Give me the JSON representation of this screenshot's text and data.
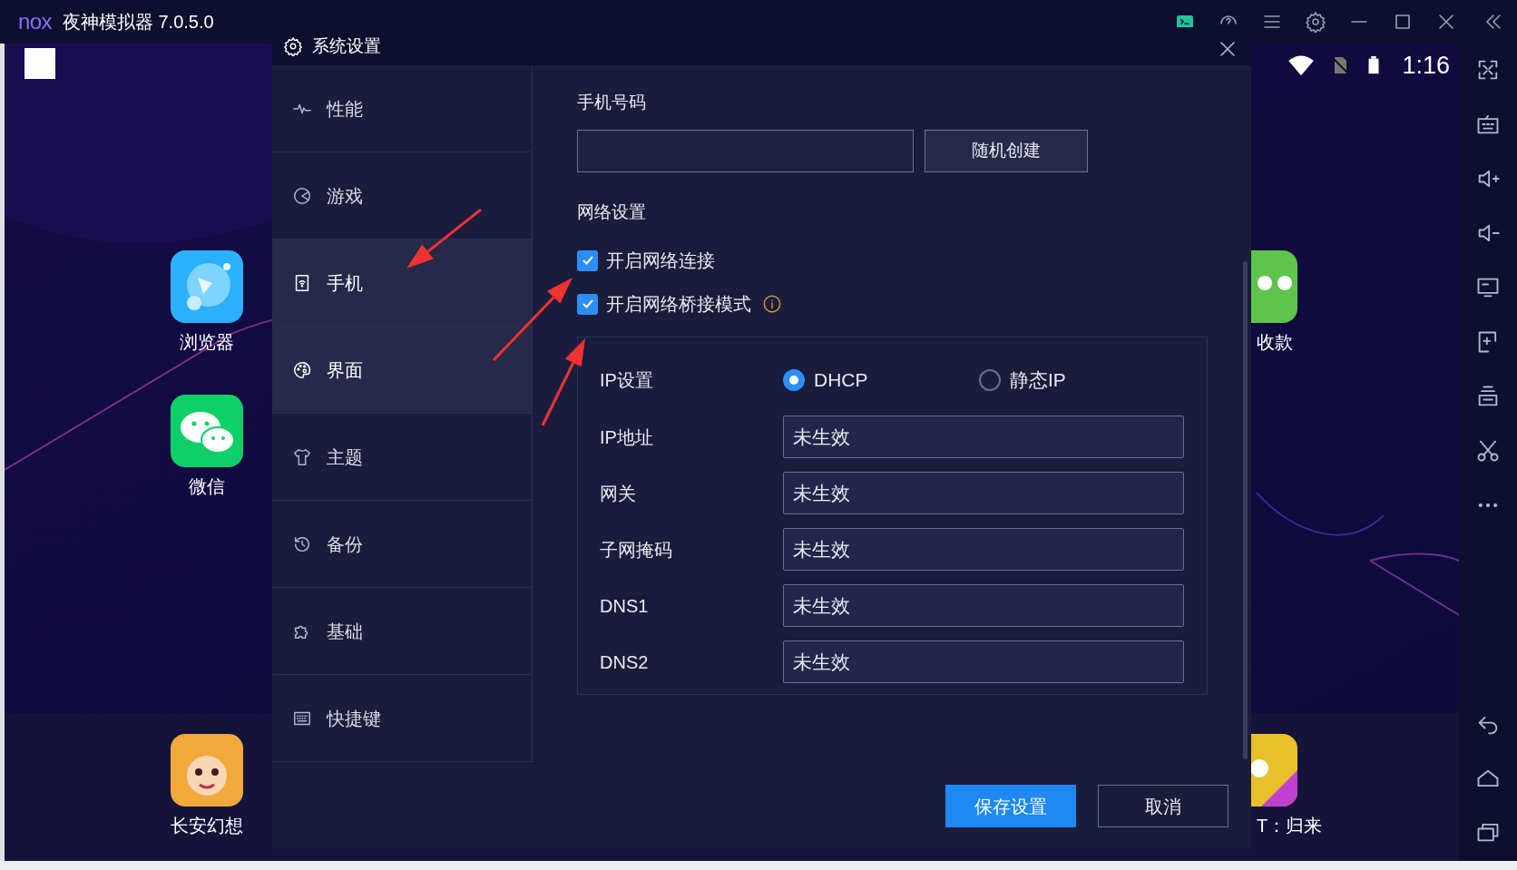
{
  "window": {
    "logo": "nox",
    "title": "夜神模拟器 7.0.5.0"
  },
  "android_status": {
    "time": "1:16"
  },
  "desktop_apps": [
    {
      "label": "浏览器",
      "kind": "browser"
    },
    {
      "label": "微信",
      "kind": "chat"
    },
    {
      "label": "收款",
      "kind": "pay"
    }
  ],
  "dock_apps": [
    {
      "label": "长安幻想",
      "kind": "game"
    },
    {
      "label": "T：归来",
      "kind": "game2"
    }
  ],
  "dialog": {
    "title": "系统设置",
    "menu": [
      {
        "label": "性能",
        "highlighted": false
      },
      {
        "label": "游戏",
        "highlighted": false
      },
      {
        "label": "手机",
        "highlighted": true
      },
      {
        "label": "界面",
        "highlighted": true
      },
      {
        "label": "主题",
        "highlighted": false
      },
      {
        "label": "备份",
        "highlighted": false
      },
      {
        "label": "基础",
        "highlighted": false
      },
      {
        "label": "快捷键",
        "highlighted": false
      }
    ],
    "phone_number": {
      "label": "手机号码",
      "button": "随机创建"
    },
    "network": {
      "heading": "网络设置",
      "options": [
        {
          "label": "开启网络连接",
          "checked": true,
          "info": false
        },
        {
          "label": "开启网络桥接模式",
          "checked": true,
          "info": true
        }
      ]
    },
    "ip_settings": {
      "label": "IP设置",
      "modes": [
        {
          "label": "DHCP",
          "selected": true
        },
        {
          "label": "静态IP",
          "selected": false
        }
      ],
      "fields": [
        {
          "label": "IP地址",
          "value": "未生效"
        },
        {
          "label": "网关",
          "value": "未生效"
        },
        {
          "label": "子网掩码",
          "value": "未生效"
        },
        {
          "label": "DNS1",
          "value": "未生效"
        },
        {
          "label": "DNS2",
          "value": "未生效"
        }
      ]
    },
    "buttons": [
      {
        "label": "保存设置",
        "kind": "primary"
      },
      {
        "label": "取消",
        "kind": "secondary"
      }
    ]
  }
}
